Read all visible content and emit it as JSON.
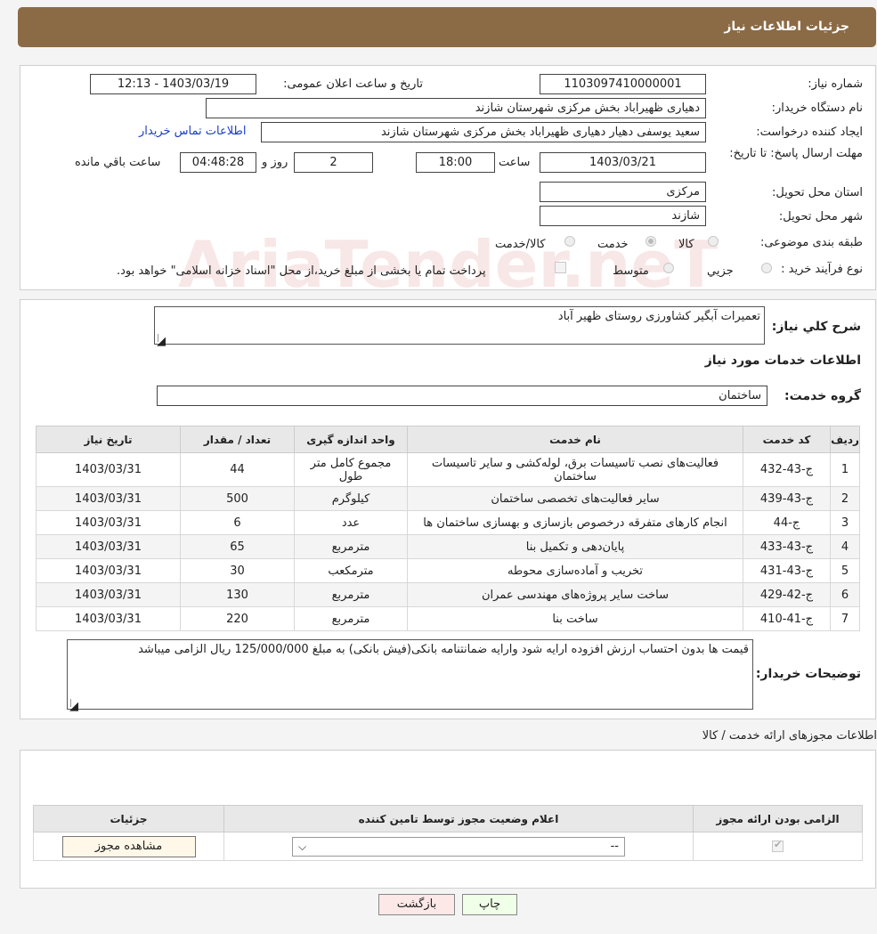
{
  "header": {
    "title": "جزئیات اطلاعات نیاز"
  },
  "info": {
    "need_number_label": "شماره نیاز:",
    "need_number": "1103097410000001",
    "announce_label": "تاریخ و ساعت اعلان عمومی:",
    "announce_value": "1403/03/19 - 12:13",
    "buyer_org_label": "نام دستگاه خریدار:",
    "buyer_org": "دهیاری ظهیراباد بخش مرکزی شهرستان شازند",
    "creator_label": "ایجاد کننده درخواست:",
    "creator": "سعید یوسفی دهیار دهیاری ظهیراباد بخش مرکزی شهرستان شازند",
    "contact_link": "اطلاعات تماس خریدار",
    "deadline_label": "مهلت ارسال پاسخ: تا تاریخ:",
    "deadline_date": "1403/03/21",
    "time_label": "ساعت",
    "deadline_time": "18:00",
    "days_value": "2",
    "days_label": "روز و",
    "remaining_time": "04:48:28",
    "remaining_label": "ساعت باقي مانده",
    "province_label": "استان محل تحویل:",
    "province": "مرکزی",
    "city_label": "شهر محل تحویل:",
    "city": "شازند",
    "category_label": "طبقه بندی موضوعی:",
    "category_options": [
      "کالا",
      "خدمت",
      "کالا/خدمت"
    ],
    "process_label": "نوع فرآیند خرید :",
    "process_options": [
      "جزیي",
      "متوسط"
    ],
    "treasury_note": "پرداخت تمام یا بخشی از مبلغ خرید،از محل \"اسناد خزانه اسلامی\" خواهد بود."
  },
  "need": {
    "summary_label": "شرح کلي نياز:",
    "summary": "تعمیرات آبگیر کشاورزی روستای ظهیر آباد",
    "services_title": "اطلاعات خدمات مورد نياز",
    "group_label": "گروه خدمت:",
    "group": "ساختمان"
  },
  "services_table": {
    "headers": [
      "رديف",
      "کد خدمت",
      "نام خدمت",
      "واحد اندازه گیری",
      "تعداد / مقدار",
      "تاريخ نياز"
    ],
    "rows": [
      [
        "1",
        "ج-43-432",
        "فعالیت‌های نصب تاسیسات برق، لوله‌کشی و سایر تاسیسات ساختمان",
        "مجموع کامل متر طول",
        "44",
        "1403/03/31"
      ],
      [
        "2",
        "ج-43-439",
        "سایر فعالیت‌های تخصصی ساختمان",
        "کیلوگرم",
        "500",
        "1403/03/31"
      ],
      [
        "3",
        "ج-44",
        "انجام کارهای متفرقه درخصوص بازسازی و بهسازی ساختمان ها",
        "عدد",
        "6",
        "1403/03/31"
      ],
      [
        "4",
        "ج-43-433",
        "پایان‌دهی و تکمیل بنا",
        "مترمربع",
        "65",
        "1403/03/31"
      ],
      [
        "5",
        "ج-43-431",
        "تخریب و آماده‌سازی محوطه",
        "مترمکعب",
        "30",
        "1403/03/31"
      ],
      [
        "6",
        "ج-42-429",
        "ساخت سایر پروژه‌های مهندسی عمران",
        "مترمربع",
        "130",
        "1403/03/31"
      ],
      [
        "7",
        "ج-41-410",
        "ساخت بنا",
        "مترمربع",
        "220",
        "1403/03/31"
      ]
    ]
  },
  "buyer_notes": {
    "label": "توضیحات خریدار:",
    "text": "قیمت ها بدون احتساب ارزش افزوده ارایه شود وارایه ضمانتنامه بانکی(فیش بانکی) به مبلغ 125/000/000 ریال الزامی میباشد"
  },
  "permits": {
    "title": "اطلاعات مجوزهای ارائه خدمت / کالا",
    "headers": [
      "الزامی بودن ارائه مجوز",
      "اعلام وضعیت مجوز توسط تامین کننده",
      "جزئیات"
    ],
    "select_value": "--",
    "view_button": "مشاهده مجوز"
  },
  "actions": {
    "print": "چاپ",
    "back": "بازگشت"
  },
  "watermark": "AriaTender.neT"
}
